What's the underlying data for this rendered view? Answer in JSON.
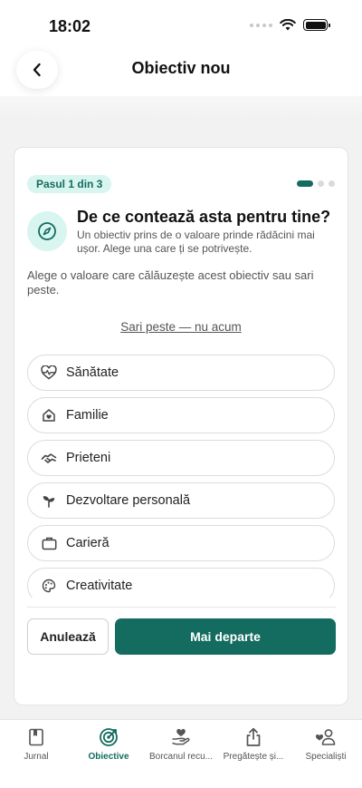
{
  "status": {
    "time": "18:02"
  },
  "nav": {
    "title": "Obiectiv nou"
  },
  "card": {
    "step": "Pasul 1 din 3",
    "step_current": 1,
    "step_total": 3,
    "title": "De ce contează asta pentru tine?",
    "subtitle": "Un obiectiv prins de o valoare prinde rădăcini mai ușor. Alege una care ți se potrivește.",
    "lead": "Alege o valoare care călăuzește acest obiectiv sau sari peste.",
    "skip_label": "Sari peste — nu acum",
    "options": [
      {
        "label": "Sănătate",
        "icon": "heart-pulse-icon"
      },
      {
        "label": "Familie",
        "icon": "home-icon"
      },
      {
        "label": "Prieteni",
        "icon": "handshake-icon"
      },
      {
        "label": "Dezvoltare personală",
        "icon": "sprout-icon"
      },
      {
        "label": "Carieră",
        "icon": "briefcase-icon"
      },
      {
        "label": "Creativitate",
        "icon": "palette-icon"
      }
    ],
    "cancel_label": "Anulează",
    "next_label": "Mai departe"
  },
  "tabs": [
    {
      "label": "Jurnal",
      "icon": "journal-icon",
      "active": false
    },
    {
      "label": "Obiective",
      "icon": "target-icon",
      "active": true
    },
    {
      "label": "Borcanul recu...",
      "icon": "hand-heart-icon",
      "active": false
    },
    {
      "label": "Pregătește și...",
      "icon": "share-icon",
      "active": false
    },
    {
      "label": "Specialiști",
      "icon": "specialists-icon",
      "active": false
    }
  ],
  "colors": {
    "accent": "#146b5f",
    "accent_light": "#d8f5ef",
    "background": "#f2f2f2"
  }
}
